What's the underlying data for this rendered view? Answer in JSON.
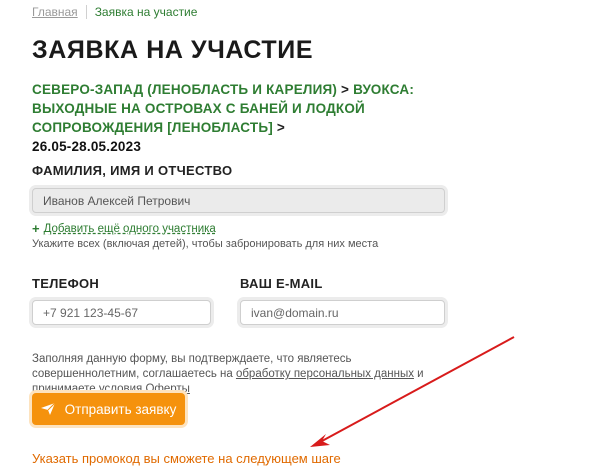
{
  "breadcrumb": {
    "home": "Главная",
    "current": "Заявка на участие"
  },
  "page_title": "ЗАЯВКА НА УЧАСТИЕ",
  "tour_path": {
    "region": "СЕВЕРО-ЗАПАД (ЛЕНОБЛАСТЬ И КАРЕЛИЯ)",
    "separator1": " > ",
    "tour": "ВУОКСА: ВЫХОДНЫЕ НА ОСТРОВАХ С БАНЕЙ И ЛОДКОЙ СОПРОВОЖДЕНИЯ [ЛЕНОБЛАСТЬ]",
    "separator2": " >",
    "dates": "26.05-28.05.2023"
  },
  "form": {
    "fio_label": "ФАМИЛИЯ, ИМЯ И ОТЧЕСТВО",
    "fio_value": "Иванов Алексей Петрович",
    "add_participant": "Добавить ещё одного участника",
    "add_participant_icon": "plus-icon",
    "hint": "Укажите всех (включая детей), чтобы забронировать для них места",
    "phone_label": "ТЕЛЕФОН",
    "phone_placeholder": "+7 921 123-45-67",
    "email_label": "ВАШ E-MAIL",
    "email_placeholder": "ivan@domain.ru"
  },
  "consent": {
    "text1": "Заполняя данную форму, вы подтверждаете, что являетесь совершеннолетним, соглашаетесь на ",
    "link1": "обработку персональных данных",
    "text2": " и принимаете условия ",
    "link2": "Оферты"
  },
  "submit": {
    "label": "Отправить заявку",
    "icon": "send-icon"
  },
  "promo_note": "Указать промокод вы сможете на следующем шаге",
  "colors": {
    "accent_green": "#2e7d32",
    "button_orange": "#f5920d",
    "promo_orange": "#e06a00",
    "annotation_red": "#d81b1b"
  }
}
